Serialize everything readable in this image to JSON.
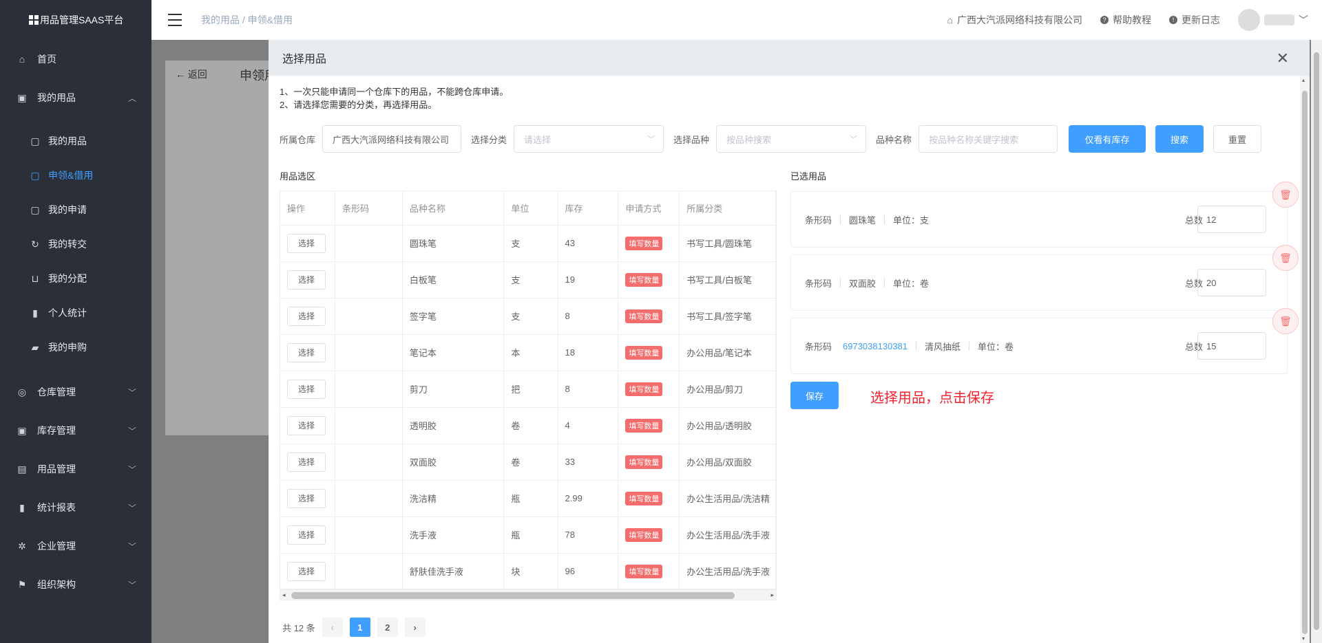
{
  "app": {
    "title": "用品管理SAAS平台"
  },
  "sidebar": {
    "home": "首页",
    "my_items": {
      "label": "我的用品",
      "children": [
        "我的用品",
        "申领&借用",
        "我的申请",
        "我的转交",
        "我的分配",
        "个人统计",
        "我的申购"
      ]
    },
    "groups": [
      "仓库管理",
      "库存管理",
      "用品管理",
      "统计报表",
      "企业管理",
      "组织架构"
    ]
  },
  "topbar": {
    "breadcrumb": "我的用品 / 申领&借用",
    "company": "广西大汽派网络科技有限公司",
    "help": "帮助教程",
    "changelog": "更新日志"
  },
  "background": {
    "back_label": "返回",
    "title": "申领用"
  },
  "drawer": {
    "title": "选择用品",
    "tips": [
      "1、一次只能申请同一个仓库下的用品，不能跨仓库申请。",
      "2、请选择您需要的分类，再选择用品。"
    ],
    "filters": {
      "warehouse_label": "所属仓库",
      "warehouse_value": "广西大汽派网络科技有限公司",
      "category_label": "选择分类",
      "category_placeholder": "请选择",
      "variety_label": "选择品种",
      "variety_placeholder": "按品种搜索",
      "name_label": "品种名称",
      "name_placeholder": "按品种名称关键字搜索",
      "btn_stock": "仅看有库存",
      "btn_search": "搜索",
      "btn_reset": "重置"
    },
    "left_section": "用品选区",
    "right_section": "已选用品",
    "table": {
      "columns": [
        "操作",
        "条形码",
        "品种名称",
        "单位",
        "库存",
        "申请方式",
        "所属分类"
      ],
      "select_label": "选择",
      "rows": [
        {
          "barcode": "",
          "name": "圆珠笔",
          "unit": "支",
          "stock": "43",
          "method": "填写数量",
          "category": "书写工具/圆珠笔"
        },
        {
          "barcode": "",
          "name": "白板笔",
          "unit": "支",
          "stock": "19",
          "method": "填写数量",
          "category": "书写工具/白板笔"
        },
        {
          "barcode": "",
          "name": "签字笔",
          "unit": "支",
          "stock": "8",
          "method": "填写数量",
          "category": "书写工具/签字笔"
        },
        {
          "barcode": "",
          "name": "笔记本",
          "unit": "本",
          "stock": "18",
          "method": "填写数量",
          "category": "办公用品/笔记本"
        },
        {
          "barcode": "",
          "name": "剪刀",
          "unit": "把",
          "stock": "8",
          "method": "填写数量",
          "category": "办公用品/剪刀"
        },
        {
          "barcode": "",
          "name": "透明胶",
          "unit": "卷",
          "stock": "4",
          "method": "填写数量",
          "category": "办公用品/透明胶"
        },
        {
          "barcode": "",
          "name": "双面胶",
          "unit": "卷",
          "stock": "33",
          "method": "填写数量",
          "category": "办公用品/双面胶"
        },
        {
          "barcode": "",
          "name": "洗洁精",
          "unit": "瓶",
          "stock": "2.99",
          "method": "填写数量",
          "category": "办公生活用品/洗洁精"
        },
        {
          "barcode": "",
          "name": "洗手液",
          "unit": "瓶",
          "stock": "78",
          "method": "填写数量",
          "category": "办公生活用品/洗手液"
        },
        {
          "barcode": "",
          "name": "舒肤佳洗手液",
          "unit": "块",
          "stock": "96",
          "method": "填写数量",
          "category": "办公生活用品/洗手液"
        }
      ]
    },
    "pagination": {
      "total": "共 12 条",
      "pages": [
        "1",
        "2"
      ],
      "current": "1"
    },
    "selected": [
      {
        "barcode_label": "条形码",
        "barcode": "",
        "name": "圆珠笔",
        "unit": "单位：支",
        "total_label": "总数",
        "total": "12"
      },
      {
        "barcode_label": "条形码",
        "barcode": "",
        "name": "双面胶",
        "unit": "单位：卷",
        "total_label": "总数",
        "total": "20"
      },
      {
        "barcode_label": "条形码",
        "barcode": "6973038130381",
        "name": "清风抽纸",
        "unit": "单位：卷",
        "total_label": "总数",
        "total": "15"
      }
    ],
    "save_label": "保存",
    "hint": "选择用品，点击保存"
  },
  "colors": {
    "primary": "#409eff",
    "danger": "#f56c6c",
    "sidebar": "#2b2f3a",
    "hint": "#f5222d"
  },
  "icons": {
    "close": "close-icon",
    "home": "home-icon",
    "delete": "trash-icon"
  }
}
